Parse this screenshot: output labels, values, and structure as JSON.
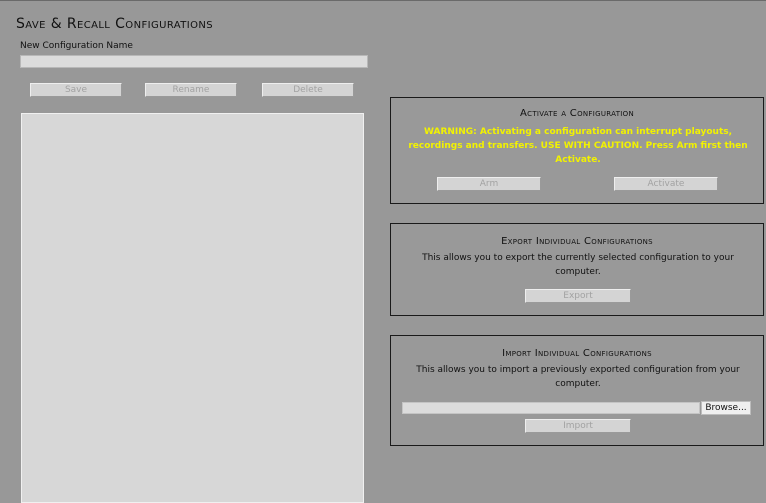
{
  "page": {
    "title": "Save & Recall Configurations",
    "name_label": "New Configuration Name",
    "name_value": "",
    "buttons": {
      "save": "Save",
      "rename": "Rename",
      "delete": "Delete"
    }
  },
  "configuration_list": {
    "items": []
  },
  "activate_panel": {
    "title": "Activate a Configuration",
    "warning": "WARNING: Activating a configuration can interrupt playouts, recordings and transfers. USE WITH CAUTION. Press Arm first then Activate.",
    "arm_label": "Arm",
    "activate_label": "Activate",
    "warning_color": "#f2f200"
  },
  "export_panel": {
    "title": "Export Individual Configurations",
    "description": "This allows you to export the currently selected configuration to your computer.",
    "export_label": "Export"
  },
  "import_panel": {
    "title": "Import Individual Configurations",
    "description": "This allows you to import a previously exported configuration from your computer.",
    "file_value": "",
    "browse_label": "Browse...",
    "import_label": "Import"
  }
}
